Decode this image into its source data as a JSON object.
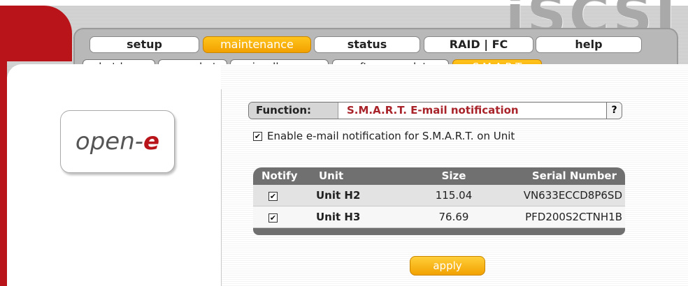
{
  "brand": {
    "product_title": "iSCSI",
    "logo_text_main": "open-",
    "logo_text_accent": "e"
  },
  "nav": {
    "tabs": [
      {
        "label": "setup",
        "active": false
      },
      {
        "label": "maintenance",
        "active": true
      },
      {
        "label": "status",
        "active": false
      },
      {
        "label": "RAID | FC",
        "active": false
      },
      {
        "label": "help",
        "active": false
      }
    ],
    "subtabs": [
      {
        "label": "shutdown",
        "active": false
      },
      {
        "label": "snapshot",
        "active": false
      },
      {
        "label": "miscellaneous",
        "active": false
      },
      {
        "label": "software update",
        "active": false
      },
      {
        "label": "S.M.A.R.T",
        "active": true
      }
    ]
  },
  "function_bar": {
    "label": "Function:",
    "value": "S.M.A.R.T. E-mail notification",
    "help": "?"
  },
  "enable_option": {
    "checked": true,
    "label": "Enable e-mail notification for S.M.A.R.T. on Unit"
  },
  "table": {
    "headers": [
      "Notify",
      "Unit",
      "Size",
      "Serial Number"
    ],
    "rows": [
      {
        "notify": true,
        "unit": "Unit H2",
        "size": "115.04",
        "serial": "VN633ECCD8P6SD"
      },
      {
        "notify": true,
        "unit": "Unit H3",
        "size": "76.69",
        "serial": "PFD200S2CTNH1B"
      }
    ]
  },
  "apply_label": "apply",
  "colors": {
    "accent": "#f2a100",
    "brand_red": "#b8141a",
    "function_value": "#a8242a",
    "table_header": "#707070"
  },
  "check_glyph": "☑"
}
